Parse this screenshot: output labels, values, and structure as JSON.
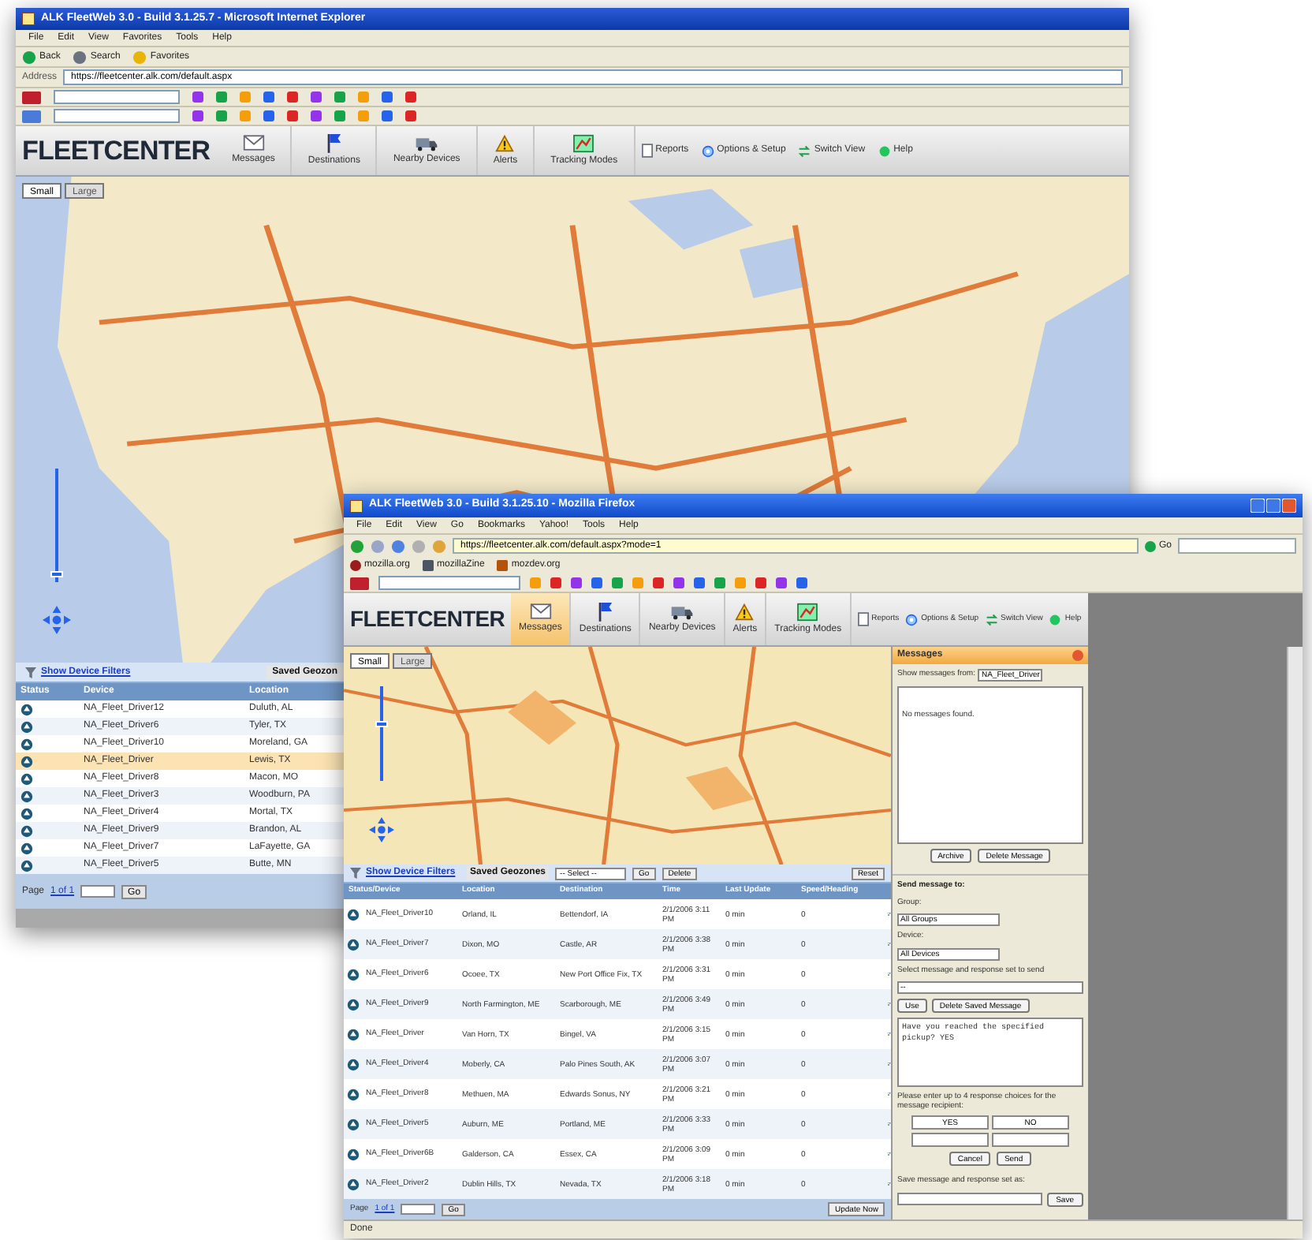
{
  "ie_window": {
    "title": "ALK FleetWeb 3.0 - Build 3.1.25.7 - Microsoft Internet Explorer",
    "menu": [
      "File",
      "Edit",
      "View",
      "Favorites",
      "Tools",
      "Help"
    ],
    "toolbar": [
      "Back",
      "Search",
      "Favorites"
    ],
    "address_label": "Address",
    "address": "https://fleetcenter.alk.com/default.aspx",
    "app": {
      "logo": "FLEETCENTER",
      "nav": [
        {
          "label": "Messages",
          "selected": false
        },
        {
          "label": "Destinations",
          "selected": false
        },
        {
          "label": "Nearby Devices",
          "selected": false
        },
        {
          "label": "Alerts",
          "selected": false
        },
        {
          "label": "Tracking Modes",
          "selected": false
        }
      ],
      "links": [
        "Reports",
        "Options & Setup",
        "Switch View",
        "Help"
      ]
    },
    "map": {
      "kind": "picture",
      "zoom": {
        "level": 0.05
      },
      "size_buttons": [
        {
          "label": "Small",
          "selected": true
        },
        {
          "label": "Large",
          "selected": false
        }
      ]
    },
    "grid": {
      "filter_link": "Show Device Filters",
      "geozones_label": "Saved Geozon",
      "columns": [
        "Status",
        "Device",
        "Location"
      ],
      "rows": [
        {
          "device": "NA_Fleet_Driver12",
          "location": "Duluth, AL",
          "selected": false
        },
        {
          "device": "NA_Fleet_Driver6",
          "location": "Tyler, TX",
          "selected": false
        },
        {
          "device": "NA_Fleet_Driver10",
          "location": "Moreland, GA",
          "selected": false
        },
        {
          "device": "NA_Fleet_Driver",
          "location": "Lewis, TX",
          "selected": true
        },
        {
          "device": "NA_Fleet_Driver8",
          "location": "Macon, MO",
          "selected": false
        },
        {
          "device": "NA_Fleet_Driver3",
          "location": "Woodburn, PA",
          "selected": false
        },
        {
          "device": "NA_Fleet_Driver4",
          "location": "Mortal, TX",
          "selected": false
        },
        {
          "device": "NA_Fleet_Driver9",
          "location": "Brandon, AL",
          "selected": false
        },
        {
          "device": "NA_Fleet_Driver7",
          "location": "LaFayette, GA",
          "selected": false
        },
        {
          "device": "NA_Fleet_Driver5",
          "location": "Butte, MN",
          "selected": false
        }
      ],
      "page_label": "Page",
      "page_text": "1 of 1",
      "go": "Go"
    }
  },
  "firefox_window": {
    "title": "ALK FleetWeb 3.0 - Build 3.1.25.10 - Mozilla Firefox",
    "menu": [
      "File",
      "Edit",
      "View",
      "Go",
      "Bookmarks",
      "Yahoo!",
      "Tools",
      "Help"
    ],
    "address": "https://fleetcenter.alk.com/default.aspx?mode=1",
    "go": "Go",
    "bookmarks": [
      "mozilla.org",
      "mozillaZine",
      "mozdev.org"
    ],
    "app": {
      "logo": "FLEETCENTER",
      "nav": [
        {
          "label": "Messages",
          "selected": true
        },
        {
          "label": "Destinations",
          "selected": false
        },
        {
          "label": "Nearby Devices",
          "selected": false
        },
        {
          "label": "Alerts",
          "selected": false
        },
        {
          "label": "Tracking Modes",
          "selected": false
        }
      ],
      "links": [
        "Reports",
        "Options & Setup",
        "Switch View",
        "Help"
      ]
    },
    "map": {
      "kind": "picture",
      "zoom": {
        "level": 0.6
      },
      "size_buttons": [
        {
          "label": "Small",
          "selected": true
        },
        {
          "label": "Large",
          "selected": false
        }
      ]
    },
    "grid": {
      "filter_link": "Show Device Filters",
      "geozones_label": "Saved Geozones",
      "geozone_select": "-- Select --",
      "buttons": [
        "Go",
        "Delete"
      ],
      "reset": "Reset",
      "columns": [
        "Status/Device",
        "Location",
        "Destination",
        "Time",
        "Last Update",
        "Speed/Heading"
      ],
      "rows": [
        {
          "device": "NA_Fleet_Driver10",
          "location": "Orland, IL",
          "destination": "Bettendorf, IA",
          "time": "2/1/2006 3:11 PM",
          "last_update": "0 min",
          "speed": "0"
        },
        {
          "device": "NA_Fleet_Driver7",
          "location": "Dixon, MO",
          "destination": "Castle, AR",
          "time": "2/1/2006 3:38 PM",
          "last_update": "0 min",
          "speed": "0"
        },
        {
          "device": "NA_Fleet_Driver6",
          "location": "Ocoee, TX",
          "destination": "New Port Office Fix, TX",
          "time": "2/1/2006 3:31 PM",
          "last_update": "0 min",
          "speed": "0"
        },
        {
          "device": "NA_Fleet_Driver9",
          "location": "North Farmington, ME",
          "destination": "Scarborough, ME",
          "time": "2/1/2006 3:49 PM",
          "last_update": "0 min",
          "speed": "0"
        },
        {
          "device": "NA_Fleet_Driver",
          "location": "Van Horn, TX",
          "destination": "Bingel, VA",
          "time": "2/1/2006 3:15 PM",
          "last_update": "0 min",
          "speed": "0"
        },
        {
          "device": "NA_Fleet_Driver4",
          "location": "Moberly, CA",
          "destination": "Palo Pines South, AK",
          "time": "2/1/2006 3:07 PM",
          "last_update": "0 min",
          "speed": "0"
        },
        {
          "device": "NA_Fleet_Driver8",
          "location": "Methuen, MA",
          "destination": "Edwards Sonus, NY",
          "time": "2/1/2006 3:21 PM",
          "last_update": "0 min",
          "speed": "0"
        },
        {
          "device": "NA_Fleet_Driver5",
          "location": "Auburn, ME",
          "destination": "Portland, ME",
          "time": "2/1/2006 3:33 PM",
          "last_update": "0 min",
          "speed": "0"
        },
        {
          "device": "NA_Fleet_Driver6B",
          "location": "Galderson, CA",
          "destination": "Essex, CA",
          "time": "2/1/2006 3:09 PM",
          "last_update": "0 min",
          "speed": "0"
        },
        {
          "device": "NA_Fleet_Driver2",
          "location": "Dublin Hills, TX",
          "destination": "Nevada, TX",
          "time": "2/1/2006 3:18 PM",
          "last_update": "0 min",
          "speed": "0"
        }
      ],
      "page_label": "Page",
      "page_text": "1 of 1",
      "go": "Go",
      "update": "Update Now"
    },
    "messages": {
      "title": "Messages",
      "show_from_label": "Show messages from:",
      "show_from": "NA_Fleet_Driver",
      "empty_text": "No messages found.",
      "list_buttons": [
        "Archive",
        "Delete Message"
      ],
      "send_title": "Send message to:",
      "group_label": "Group:",
      "group": "All Groups",
      "device_label": "Device:",
      "device": "All Devices",
      "saved_label": "Select message and response set to send",
      "saved": "--",
      "saved_buttons": [
        "Use",
        "Delete Saved Message"
      ],
      "message_text": "Have you reached the specified pickup? YES",
      "choices_label": "Please enter up to 4 response choices for the message recipient:",
      "choices": [
        "YES",
        "NO"
      ],
      "send_buttons": [
        "Cancel",
        "Send"
      ],
      "save_label": "Save message and response set as:",
      "save_button": "Save"
    },
    "status": "Done"
  }
}
